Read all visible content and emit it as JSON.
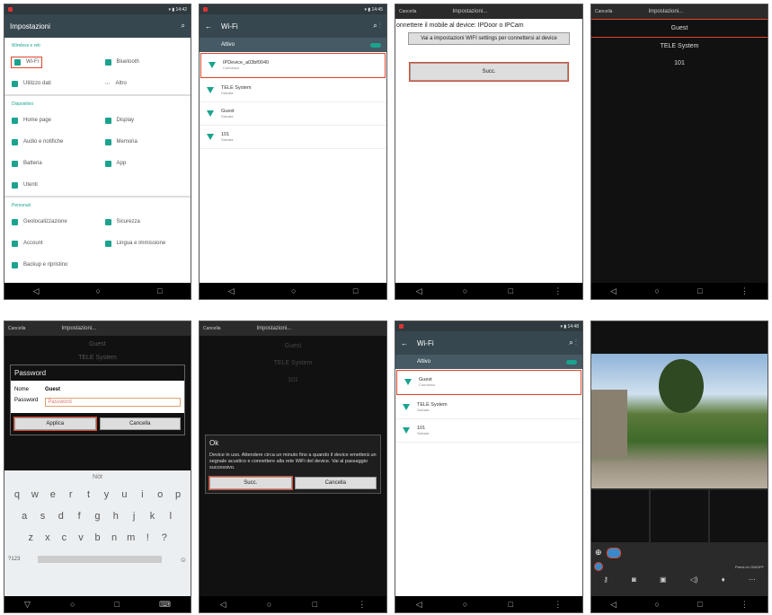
{
  "p1": {
    "title": "Impostazioni",
    "s1": "Wireless e reti",
    "wifi": "Wi-Fi",
    "bt": "Bluetooth",
    "data": "Utilizzo dati",
    "altro": "Altro",
    "s2": "Dispositivo",
    "home": "Home page",
    "display": "Display",
    "audio": "Audio e notifiche",
    "mem": "Memoria",
    "batt": "Batteria",
    "app": "App",
    "utenti": "Utenti",
    "s3": "Personali",
    "geo": "Geolocalizzazione",
    "sic": "Sicurezza",
    "acc": "Account",
    "lingua": "Lingua e immissione",
    "backup": "Backup e ripristino"
  },
  "p2": {
    "title": "Wi-Fi",
    "attivo": "Attivo",
    "n1": "IPDevice_a03bf0040",
    "n1s": "Connesso",
    "n2": "TELE System",
    "n2s": "Salvata",
    "n3": "Guest",
    "n3s": "Salvata",
    "n4": "101",
    "n4s": "Salvata"
  },
  "p3": {
    "cancel": "Cancella",
    "title": "Impostazioni...",
    "msg": "onnettere il mobile al device: IPDoor o IPCam",
    "btn1": "Vai a impostazioni WIFI settings per connettersi al device",
    "btn2": "Succ."
  },
  "p4": {
    "cancel": "Cancella",
    "title": "Impostazioni...",
    "i1": "Guest",
    "i2": "TELE System",
    "i3": "101"
  },
  "p5": {
    "cancel": "Cancella",
    "title": "Impostazioni...",
    "i1": "Guest",
    "i2": "TELE System",
    "pw_title": "Password",
    "nome_l": "Nome",
    "nome_v": "Guest",
    "pw_l": "Password",
    "pw_ph": "Password",
    "applica": "Applica",
    "cancella": "Cancella",
    "sugg": "Nòt",
    "row1": [
      "q",
      "w",
      "e",
      "r",
      "t",
      "y",
      "u",
      "i",
      "o",
      "p"
    ],
    "row2": [
      "a",
      "s",
      "d",
      "f",
      "g",
      "h",
      "j",
      "k",
      "l"
    ],
    "row3": [
      "z",
      "x",
      "c",
      "v",
      "b",
      "n",
      "m",
      "!",
      "?"
    ],
    "n123": "?123"
  },
  "p6": {
    "cancel": "Cancella",
    "title": "Impostazioni...",
    "i1": "Guest",
    "i2": "TELE System",
    "i3": "101",
    "ok": "Ok",
    "msg": "Device in uso. Attendere circa un minuto fino a quando il device emetterà un segnale acustico e connettere alla rete WiFi del device. Vai al passaggio successivo.",
    "succ": "Succ.",
    "cancella": "Cancella"
  },
  "p7": {
    "title": "Wi-Fi",
    "attivo": "Attivo",
    "n1": "Guest",
    "n1s": "Connesso",
    "n2": "TELE System",
    "n2s": "Salvata",
    "n3": "101",
    "n3s": "Salvata"
  },
  "p8": {
    "hint": "Premi ch ON/OFF"
  },
  "colors": {
    "accent": "#1aa38f",
    "highlight": "#e0462a",
    "toolbar": "#37474f"
  }
}
